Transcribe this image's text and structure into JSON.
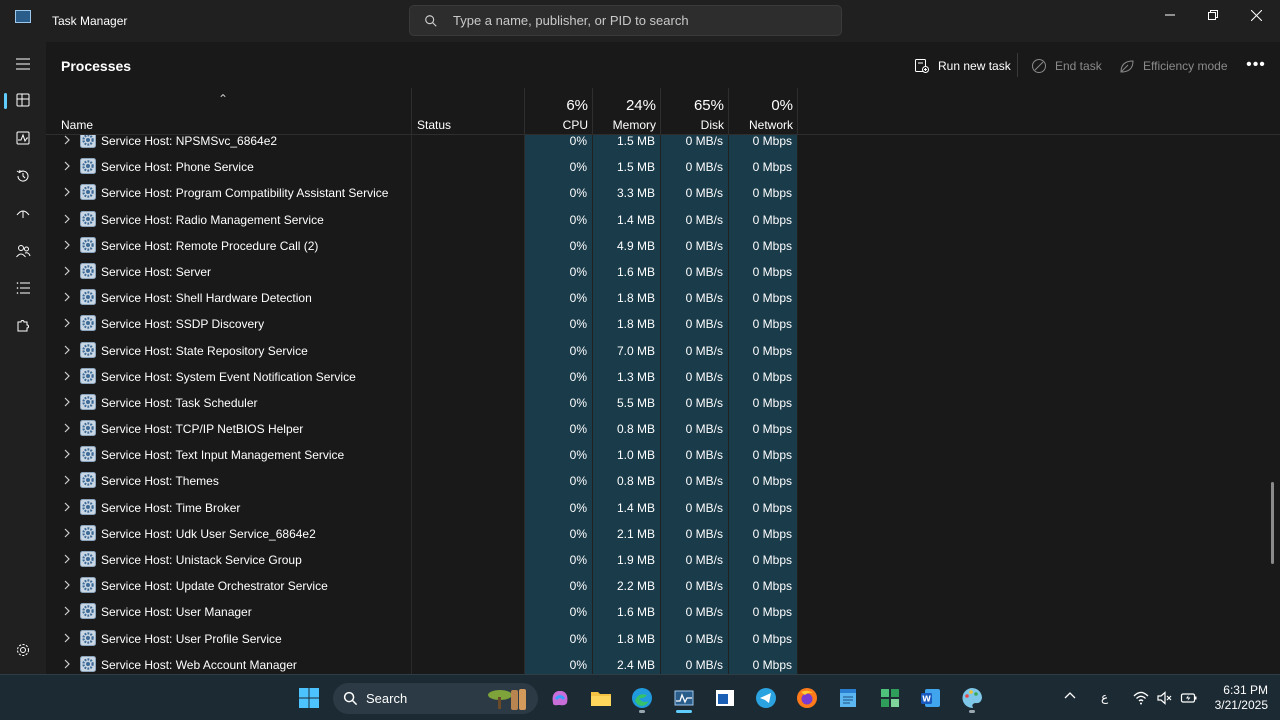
{
  "window": {
    "title": "Task Manager",
    "search_placeholder": "Type a name, publisher, or PID to search"
  },
  "toolbar": {
    "page_title": "Processes",
    "run_new_task": "Run new task",
    "end_task": "End task",
    "efficiency_mode": "Efficiency mode",
    "more": "•••"
  },
  "columns": {
    "name": "Name",
    "status": "Status",
    "cpu_pct": "6%",
    "cpu": "CPU",
    "memory_pct": "24%",
    "memory": "Memory",
    "disk_pct": "65%",
    "disk": "Disk",
    "network_pct": "0%",
    "network": "Network"
  },
  "processes": [
    {
      "name": "Service Host: NPSMSvc_6864e2",
      "cpu": "0%",
      "memory": "1.5 MB",
      "disk": "0 MB/s",
      "network": "0 Mbps"
    },
    {
      "name": "Service Host: Phone Service",
      "cpu": "0%",
      "memory": "1.5 MB",
      "disk": "0 MB/s",
      "network": "0 Mbps"
    },
    {
      "name": "Service Host: Program Compatibility Assistant Service",
      "cpu": "0%",
      "memory": "3.3 MB",
      "disk": "0 MB/s",
      "network": "0 Mbps"
    },
    {
      "name": "Service Host: Radio Management Service",
      "cpu": "0%",
      "memory": "1.4 MB",
      "disk": "0 MB/s",
      "network": "0 Mbps"
    },
    {
      "name": "Service Host: Remote Procedure Call (2)",
      "cpu": "0%",
      "memory": "4.9 MB",
      "disk": "0 MB/s",
      "network": "0 Mbps"
    },
    {
      "name": "Service Host: Server",
      "cpu": "0%",
      "memory": "1.6 MB",
      "disk": "0 MB/s",
      "network": "0 Mbps"
    },
    {
      "name": "Service Host: Shell Hardware Detection",
      "cpu": "0%",
      "memory": "1.8 MB",
      "disk": "0 MB/s",
      "network": "0 Mbps"
    },
    {
      "name": "Service Host: SSDP Discovery",
      "cpu": "0%",
      "memory": "1.8 MB",
      "disk": "0 MB/s",
      "network": "0 Mbps"
    },
    {
      "name": "Service Host: State Repository Service",
      "cpu": "0%",
      "memory": "7.0 MB",
      "disk": "0 MB/s",
      "network": "0 Mbps"
    },
    {
      "name": "Service Host: System Event Notification Service",
      "cpu": "0%",
      "memory": "1.3 MB",
      "disk": "0 MB/s",
      "network": "0 Mbps"
    },
    {
      "name": "Service Host: Task Scheduler",
      "cpu": "0%",
      "memory": "5.5 MB",
      "disk": "0 MB/s",
      "network": "0 Mbps"
    },
    {
      "name": "Service Host: TCP/IP NetBIOS Helper",
      "cpu": "0%",
      "memory": "0.8 MB",
      "disk": "0 MB/s",
      "network": "0 Mbps"
    },
    {
      "name": "Service Host: Text Input Management Service",
      "cpu": "0%",
      "memory": "1.0 MB",
      "disk": "0 MB/s",
      "network": "0 Mbps"
    },
    {
      "name": "Service Host: Themes",
      "cpu": "0%",
      "memory": "0.8 MB",
      "disk": "0 MB/s",
      "network": "0 Mbps"
    },
    {
      "name": "Service Host: Time Broker",
      "cpu": "0%",
      "memory": "1.4 MB",
      "disk": "0 MB/s",
      "network": "0 Mbps"
    },
    {
      "name": "Service Host: Udk User Service_6864e2",
      "cpu": "0%",
      "memory": "2.1 MB",
      "disk": "0 MB/s",
      "network": "0 Mbps"
    },
    {
      "name": "Service Host: Unistack Service Group",
      "cpu": "0%",
      "memory": "1.9 MB",
      "disk": "0 MB/s",
      "network": "0 Mbps"
    },
    {
      "name": "Service Host: Update Orchestrator Service",
      "cpu": "0%",
      "memory": "2.2 MB",
      "disk": "0 MB/s",
      "network": "0 Mbps"
    },
    {
      "name": "Service Host: User Manager",
      "cpu": "0%",
      "memory": "1.6 MB",
      "disk": "0 MB/s",
      "network": "0 Mbps"
    },
    {
      "name": "Service Host: User Profile Service",
      "cpu": "0%",
      "memory": "1.8 MB",
      "disk": "0 MB/s",
      "network": "0 Mbps"
    },
    {
      "name": "Service Host: Web Account Manager",
      "cpu": "0%",
      "memory": "2.4 MB",
      "disk": "0 MB/s",
      "network": "0 Mbps"
    }
  ],
  "taskbar": {
    "search_label": "Search",
    "language": "ع",
    "time": "6:31 PM",
    "date": "3/21/2025"
  },
  "colors": {
    "accent": "#60cdff",
    "heat_cell": "#1a3b4a",
    "background": "#191919"
  }
}
